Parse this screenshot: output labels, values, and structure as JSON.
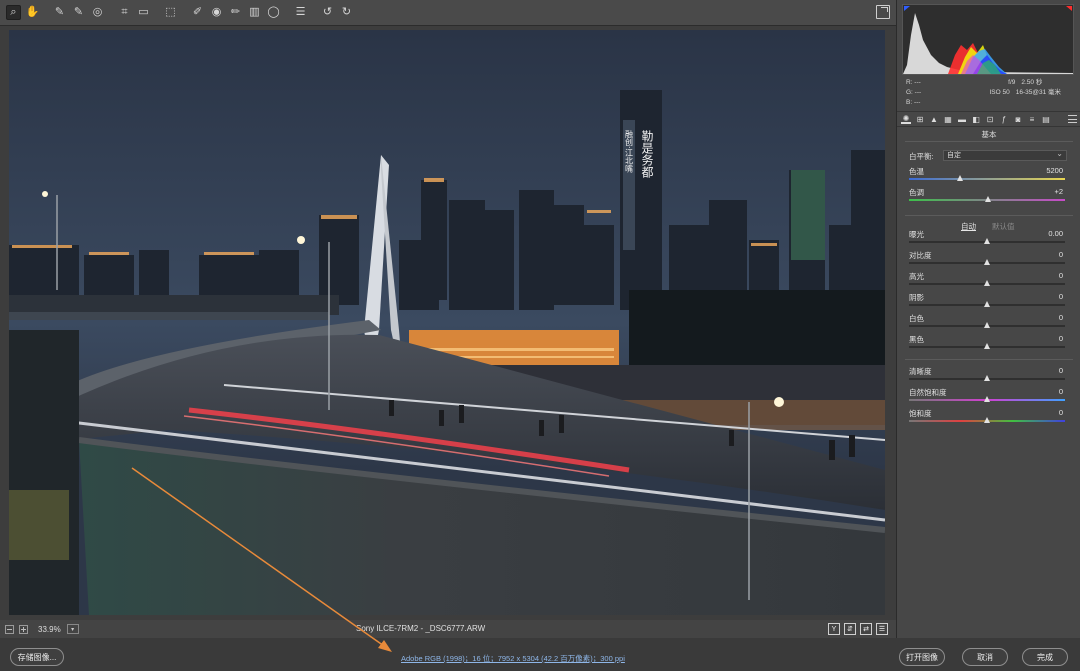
{
  "toolbar": {
    "tools": [
      {
        "name": "zoom-tool",
        "glyph": "⌕",
        "active": true
      },
      {
        "name": "hand-tool",
        "glyph": "✋"
      },
      {
        "name": "white-balance-tool",
        "glyph": "✎"
      },
      {
        "name": "color-sampler-tool",
        "glyph": "✎"
      },
      {
        "name": "targeted-adjustment-tool",
        "glyph": "◎"
      },
      {
        "name": "crop-tool",
        "glyph": "⌗"
      },
      {
        "name": "straighten-tool",
        "glyph": "▭"
      },
      {
        "name": "transform-tool",
        "glyph": "⬚"
      },
      {
        "name": "spot-removal-tool",
        "glyph": "✐"
      },
      {
        "name": "red-eye-tool",
        "glyph": "◉"
      },
      {
        "name": "adjustment-brush-tool",
        "glyph": "✏"
      },
      {
        "name": "graduated-filter-tool",
        "glyph": "▥"
      },
      {
        "name": "radial-filter-tool",
        "glyph": "◯"
      },
      {
        "name": "preferences-tool",
        "glyph": "☰"
      },
      {
        "name": "rotate-left-tool",
        "glyph": "↺"
      },
      {
        "name": "rotate-right-tool",
        "glyph": "↻"
      }
    ]
  },
  "status": {
    "zoom": "33.9%",
    "filename": "Sony ILCE-7RM2  -  _DSC6777.ARW",
    "view_buttons": [
      "Y",
      "⇵",
      "⇄",
      "☰"
    ]
  },
  "bottom": {
    "save_label": "存储图像...",
    "workflow_text": "Adobe RGB (1998)；16 位；7952 x 5304 (42.2 百万像素)；300 ppi",
    "open_label": "打开图像",
    "cancel_label": "取消",
    "done_label": "完成"
  },
  "readout": {
    "r": "R:  ---",
    "g": "G:  ---",
    "b": "B:  ---",
    "aperture": "f/9",
    "shutter": "2.50 秒",
    "iso": "ISO 50",
    "lens": "16-35@31 毫米"
  },
  "panel": {
    "section_title": "基本",
    "white_balance_label": "白平衡:",
    "white_balance_value": "自定",
    "auto_label": "自动",
    "default_label": "默认值",
    "sliders": [
      {
        "key": "temp",
        "label": "色温",
        "value": "5200",
        "level": 0.33
      },
      {
        "key": "tint",
        "label": "色调",
        "value": "+2",
        "level": 0.51
      },
      {
        "key": "exposure",
        "label": "曝光",
        "value": "0.00",
        "level": 0.5
      },
      {
        "key": "contrast",
        "label": "对比度",
        "value": "0",
        "level": 0.5
      },
      {
        "key": "highlights",
        "label": "高光",
        "value": "0",
        "level": 0.5
      },
      {
        "key": "shadows",
        "label": "阴影",
        "value": "0",
        "level": 0.5
      },
      {
        "key": "whites",
        "label": "白色",
        "value": "0",
        "level": 0.5
      },
      {
        "key": "blacks",
        "label": "黑色",
        "value": "0",
        "level": 0.5
      },
      {
        "key": "clarity",
        "label": "清晰度",
        "value": "0",
        "level": 0.5
      },
      {
        "key": "vibrance",
        "label": "自然饱和度",
        "value": "0",
        "level": 0.5
      },
      {
        "key": "saturation",
        "label": "饱和度",
        "value": "0",
        "level": 0.5
      }
    ]
  },
  "photo": {
    "tower_sign": "融创·江北嘴",
    "tower_sign_right": "勒是务都"
  },
  "colors": {
    "accent_link": "#8eb6e8",
    "annotation_arrow": "#e88a3a"
  }
}
